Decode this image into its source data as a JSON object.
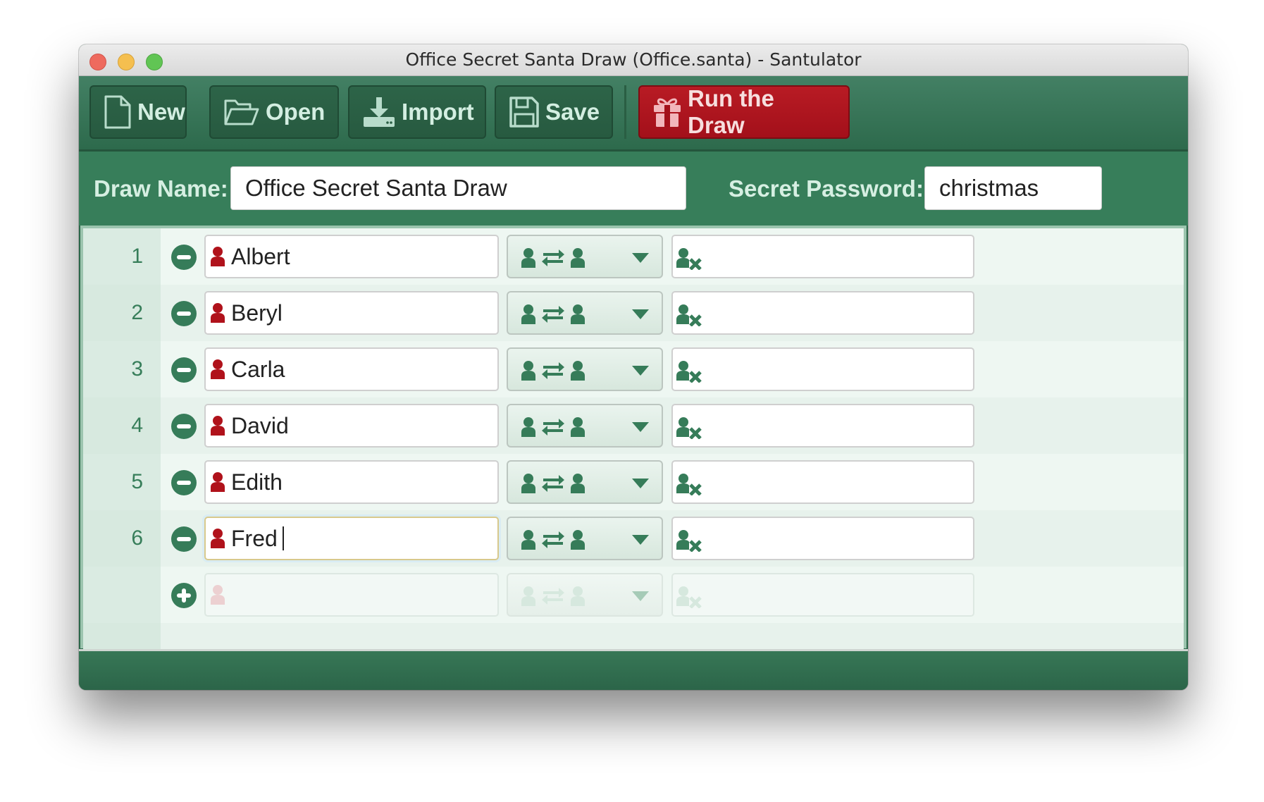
{
  "window": {
    "title": "Office Secret Santa Draw (Office.santa) - Santulator"
  },
  "toolbar": {
    "buttons": [
      {
        "label": "New",
        "icon": "new-file-icon"
      },
      {
        "label": "Open",
        "icon": "folder-open-icon"
      },
      {
        "label": "Import",
        "icon": "import-download-icon"
      },
      {
        "label": "Save",
        "icon": "floppy-disk-icon"
      }
    ],
    "run": {
      "label": "Run the Draw",
      "icon": "gift-icon"
    }
  },
  "form": {
    "draw_name_label": "Draw Name:",
    "draw_name_value": "Office Secret Santa Draw",
    "password_label": "Secret Password:",
    "password_value": "christmas"
  },
  "participants": [
    {
      "number": "1",
      "name": "Albert",
      "pairing": "two-way-exchange",
      "excluded": ""
    },
    {
      "number": "2",
      "name": "Beryl",
      "pairing": "two-way-exchange",
      "excluded": ""
    },
    {
      "number": "3",
      "name": "Carla",
      "pairing": "two-way-exchange",
      "excluded": ""
    },
    {
      "number": "4",
      "name": "David",
      "pairing": "two-way-exchange",
      "excluded": ""
    },
    {
      "number": "5",
      "name": "Edith",
      "pairing": "two-way-exchange",
      "excluded": ""
    },
    {
      "number": "6",
      "name": "Fred",
      "pairing": "two-way-exchange",
      "excluded": "",
      "focused": true
    }
  ],
  "new_row": {
    "name": "",
    "excluded": ""
  },
  "colors": {
    "brand_green": "#377e5a",
    "run_red": "#b81b24",
    "person_red": "#b0121b"
  }
}
